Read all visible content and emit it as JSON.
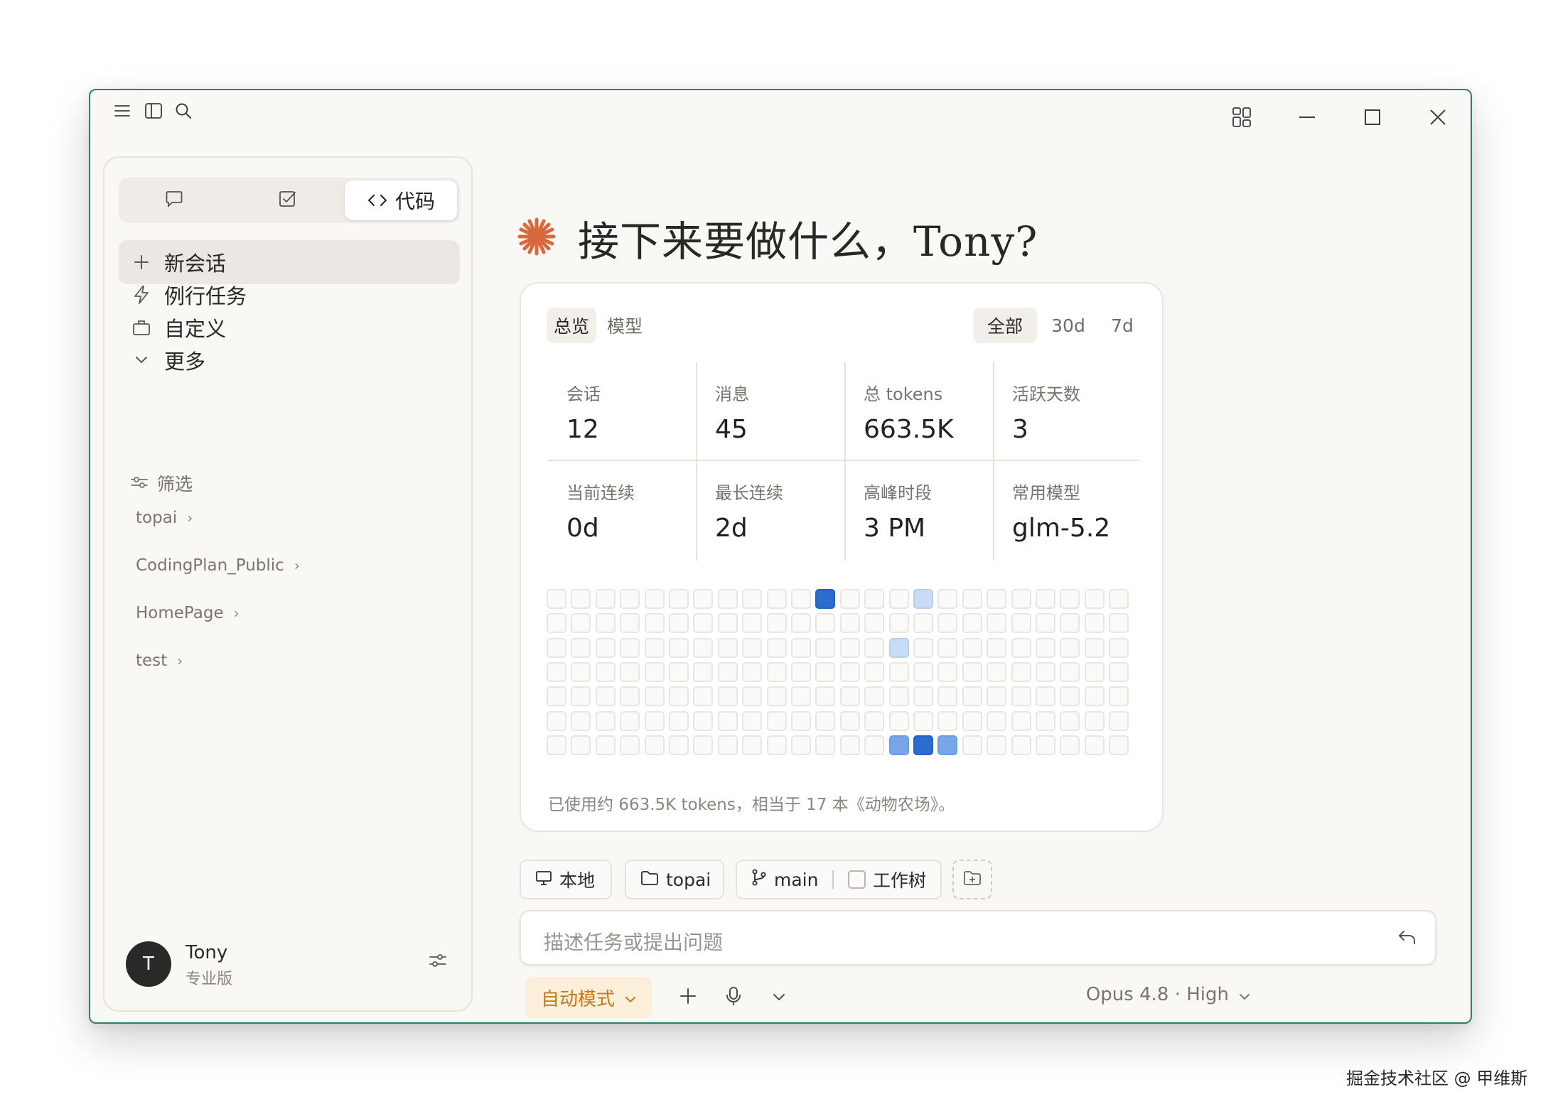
{
  "sidebar": {
    "mode_tabs": [
      {
        "icon": "chat-icon",
        "label": ""
      },
      {
        "icon": "task-check-icon",
        "label": ""
      },
      {
        "icon": "code-icon",
        "label": "代码"
      }
    ],
    "nav": {
      "new_chat": "新会话",
      "routine": "例行任务",
      "customize": "自定义",
      "more": "更多"
    },
    "filter_label": "筛选",
    "projects": [
      "topai",
      "CodingPlan_Public",
      "HomePage",
      "test"
    ],
    "user": {
      "initial": "T",
      "name": "Tony",
      "plan": "专业版"
    }
  },
  "main": {
    "greeting": "接下来要做什么，Tony?",
    "accent_color": "#d9683c",
    "stats_tabs": [
      "总览",
      "模型"
    ],
    "range_tabs": [
      "全部",
      "30d",
      "7d"
    ],
    "metrics": [
      {
        "label": "会话",
        "value": "12"
      },
      {
        "label": "消息",
        "value": "45"
      },
      {
        "label": "总 tokens",
        "value": "663.5K"
      },
      {
        "label": "活跃天数",
        "value": "3"
      },
      {
        "label": "当前连续",
        "value": "0d"
      },
      {
        "label": "最长连续",
        "value": "2d"
      },
      {
        "label": "高峰时段",
        "value": "3 PM"
      },
      {
        "label": "常用模型",
        "value": "glm-5.2"
      }
    ],
    "heatmap": {
      "columns": 24,
      "rows": 7,
      "active_cells": [
        {
          "col": 11,
          "row": 0,
          "level": 3
        },
        {
          "col": 15,
          "row": 0,
          "level": 1
        },
        {
          "col": 14,
          "row": 2,
          "level": 1
        },
        {
          "col": 14,
          "row": 6,
          "level": 2
        },
        {
          "col": 15,
          "row": 6,
          "level": 3
        },
        {
          "col": 16,
          "row": 6,
          "level": 2
        }
      ],
      "level_colors": [
        "#fafaf8",
        "#c9dcf5",
        "#77a7e6",
        "#2b6ccf"
      ]
    },
    "footnote": "已使用约 663.5K tokens，相当于 17 本《动物农场》。"
  },
  "composer": {
    "chips": {
      "location": "本地",
      "folder": "topai",
      "branch": "main",
      "worktree": "工作树"
    },
    "placeholder": "描述任务或提出问题",
    "mode": "自动模式",
    "model": "Opus 4.8 · High"
  },
  "watermark": "掘金技术社区 @ 甲维斯"
}
